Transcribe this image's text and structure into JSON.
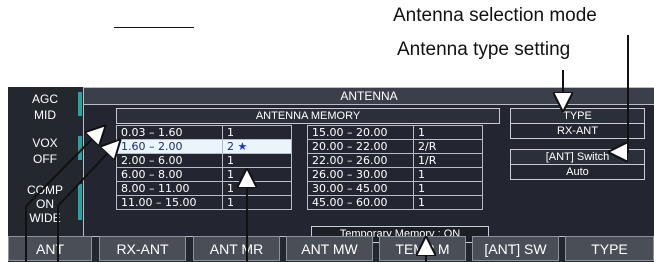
{
  "callouts": {
    "mode": "Antenna selection mode",
    "type_setting": "Antenna type setting"
  },
  "side": [
    {
      "label": "AGC",
      "value": "MID"
    },
    {
      "label": "VOX",
      "value": "OFF"
    },
    {
      "label": "COMP",
      "value": "ON",
      "extra": "WIDE"
    }
  ],
  "window": {
    "title": "ANTENNA",
    "memory_title": "ANTENNA MEMORY",
    "left_rows": [
      {
        "from": "0.03",
        "to": "1.60",
        "val": "1",
        "star": false
      },
      {
        "from": "1.60",
        "to": "2.00",
        "val": "2",
        "star": true
      },
      {
        "from": "2.00",
        "to": "6.00",
        "val": "1",
        "star": false
      },
      {
        "from": "6.00",
        "to": "8.00",
        "val": "1",
        "star": false
      },
      {
        "from": "8.00",
        "to": "11.00",
        "val": "1",
        "star": false
      },
      {
        "from": "11.00",
        "to": "15.00",
        "val": "1",
        "star": false
      }
    ],
    "right_rows": [
      {
        "from": "15.00",
        "to": "20.00",
        "val": "1"
      },
      {
        "from": "20.00",
        "to": "22.00",
        "val": "2/R"
      },
      {
        "from": "22.00",
        "to": "26.00",
        "val": "1/R"
      },
      {
        "from": "26.00",
        "to": "30.00",
        "val": "1"
      },
      {
        "from": "30.00",
        "to": "45.00",
        "val": "1"
      },
      {
        "from": "45.00",
        "to": "60.00",
        "val": "1"
      }
    ],
    "temp_memory": "Temporary Memory :  ON",
    "type_header": "TYPE",
    "type_value": "RX-ANT",
    "switch_header": "[ANT] Switch",
    "switch_value": "Auto",
    "star_glyph": "★"
  },
  "softkeys": [
    "ANT",
    "RX-ANT",
    "ANT MR",
    "ANT MW",
    "TEMP M",
    "[ANT] SW",
    "TYPE"
  ]
}
